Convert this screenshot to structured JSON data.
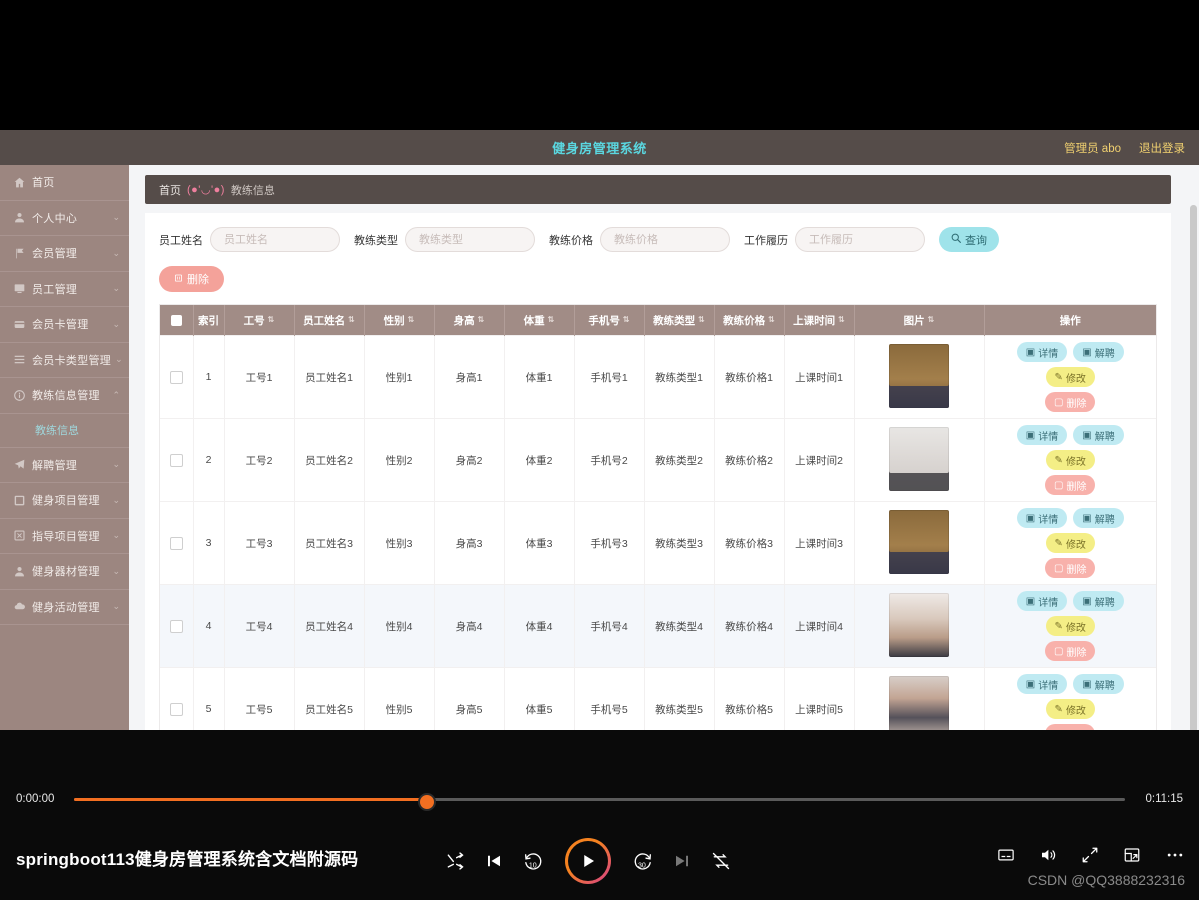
{
  "app": {
    "title": "健身房管理系统",
    "user": "管理员 abo",
    "logout": "退出登录"
  },
  "breadcrumb": {
    "home": "首页",
    "separator": "(●'◡'●)",
    "current": "教练信息"
  },
  "sidebar": {
    "items": [
      {
        "label": "首页",
        "icon": "home-icon",
        "expandable": false
      },
      {
        "label": "个人中心",
        "icon": "user-icon",
        "expandable": true
      },
      {
        "label": "会员管理",
        "icon": "flag-icon",
        "expandable": true
      },
      {
        "label": "员工管理",
        "icon": "monitor-icon",
        "expandable": true
      },
      {
        "label": "会员卡管理",
        "icon": "card-icon",
        "expandable": true
      },
      {
        "label": "会员卡类型管理",
        "icon": "list-icon",
        "expandable": true
      },
      {
        "label": "教练信息管理",
        "icon": "info-icon",
        "expandable": true,
        "expanded": true
      },
      {
        "label": "解聘管理",
        "icon": "send-icon",
        "expandable": true
      },
      {
        "label": "健身项目管理",
        "icon": "grid-icon",
        "expandable": true
      },
      {
        "label": "指导项目管理",
        "icon": "box-icon",
        "expandable": true
      },
      {
        "label": "健身器材管理",
        "icon": "person-icon",
        "expandable": true
      },
      {
        "label": "健身活动管理",
        "icon": "cloud-icon",
        "expandable": true
      }
    ],
    "active_sub": "教练信息"
  },
  "search": {
    "fields": [
      {
        "label": "员工姓名",
        "placeholder": "员工姓名",
        "value": ""
      },
      {
        "label": "教练类型",
        "placeholder": "教练类型",
        "value": ""
      },
      {
        "label": "教练价格",
        "placeholder": "教练价格",
        "value": ""
      },
      {
        "label": "工作履历",
        "placeholder": "工作履历",
        "value": ""
      }
    ],
    "query_button": "查询",
    "query_icon": "search-icon"
  },
  "toolbar": {
    "delete_label": "删除",
    "delete_icon": "trash-icon"
  },
  "table": {
    "columns": [
      {
        "label": "",
        "sortable": false,
        "key": "check"
      },
      {
        "label": "索引",
        "sortable": false,
        "key": "index"
      },
      {
        "label": "工号",
        "sortable": true,
        "key": "staff_no"
      },
      {
        "label": "员工姓名",
        "sortable": true,
        "key": "name"
      },
      {
        "label": "性别",
        "sortable": true,
        "key": "gender"
      },
      {
        "label": "身高",
        "sortable": true,
        "key": "height"
      },
      {
        "label": "体重",
        "sortable": true,
        "key": "weight"
      },
      {
        "label": "手机号",
        "sortable": true,
        "key": "phone"
      },
      {
        "label": "教练类型",
        "sortable": true,
        "key": "coach_type"
      },
      {
        "label": "教练价格",
        "sortable": true,
        "key": "coach_price"
      },
      {
        "label": "上课时间",
        "sortable": true,
        "key": "class_time"
      },
      {
        "label": "图片",
        "sortable": true,
        "key": "photo"
      },
      {
        "label": "操作",
        "sortable": false,
        "key": "ops"
      }
    ],
    "rows": [
      {
        "index": "1",
        "staff_no": "工号1",
        "name": "员工姓名1",
        "gender": "性别1",
        "height": "身高1",
        "weight": "体重1",
        "phone": "手机号1",
        "coach_type": "教练类型1",
        "coach_price": "教练价格1",
        "class_time": "上课时间1",
        "photo": "male-gym-selfie",
        "highlight": false
      },
      {
        "index": "2",
        "staff_no": "工号2",
        "name": "员工姓名2",
        "gender": "性别2",
        "height": "身高2",
        "weight": "体重2",
        "phone": "手机号2",
        "coach_type": "教练类型2",
        "coach_price": "教练价格2",
        "class_time": "上课时间2",
        "photo": "female-pink-top",
        "highlight": false
      },
      {
        "index": "3",
        "staff_no": "工号3",
        "name": "员工姓名3",
        "gender": "性别3",
        "height": "身高3",
        "weight": "体重3",
        "phone": "手机号3",
        "coach_type": "教练类型3",
        "coach_price": "教练价格3",
        "class_time": "上课时间3",
        "photo": "male-gym-selfie",
        "highlight": false
      },
      {
        "index": "4",
        "staff_no": "工号4",
        "name": "员工姓名4",
        "gender": "性别4",
        "height": "身高4",
        "weight": "体重4",
        "phone": "手机号4",
        "coach_type": "教练类型4",
        "coach_price": "教练价格4",
        "class_time": "上课时间4",
        "photo": "female-brown-top",
        "highlight": true
      },
      {
        "index": "5",
        "staff_no": "工号5",
        "name": "员工姓名5",
        "gender": "性别5",
        "height": "身高5",
        "weight": "体重5",
        "phone": "手机号5",
        "coach_type": "教练类型5",
        "coach_price": "教练价格5",
        "class_time": "上课时间5",
        "photo": "female-dark-top",
        "highlight": false
      }
    ],
    "ops": {
      "detail": "详情",
      "fire": "解聘",
      "edit": "修改",
      "delete": "删除"
    }
  },
  "player": {
    "current_time": "0:00:00",
    "total_time": "0:11:15",
    "progress_percent": 33.4,
    "video_title": "springboot113健身房管理系统含文档附源码",
    "watermark": "CSDN @QQ3888232316",
    "controls": [
      "shuffle-icon",
      "previous-icon",
      "rewind-10-icon",
      "play-icon",
      "forward-30-icon",
      "next-icon",
      "autoplay-off-icon"
    ],
    "right_controls": [
      "subtitles-icon",
      "volume-icon",
      "fullscreen-icon",
      "popout-icon",
      "more-icon"
    ]
  },
  "colors": {
    "accent_orange": "#f36f21",
    "sidebar": "#9c8680",
    "header": "#554c49",
    "table_header": "#a18c86",
    "title_cyan": "#5ad7e0",
    "user_gold": "#f0d070"
  }
}
